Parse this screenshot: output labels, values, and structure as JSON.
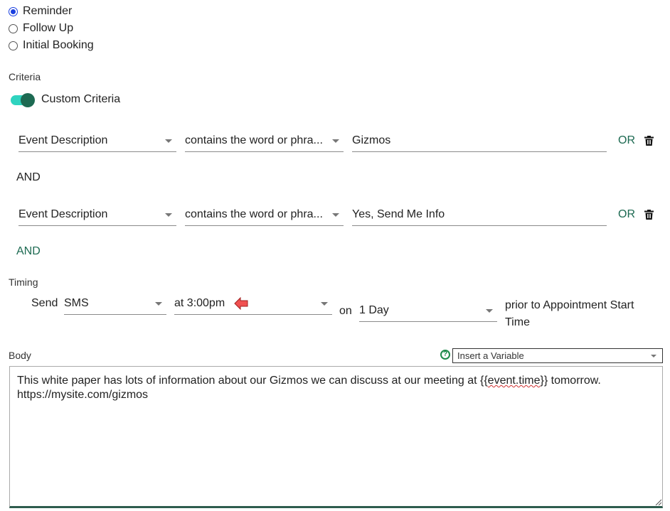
{
  "type_options": [
    {
      "label": "Reminder",
      "checked": true
    },
    {
      "label": "Follow Up",
      "checked": false
    },
    {
      "label": "Initial Booking",
      "checked": false
    }
  ],
  "criteria": {
    "section_label": "Criteria",
    "toggle_label": "Custom Criteria",
    "toggle_on": true,
    "rules": [
      {
        "field": "Event Description",
        "operator": "contains the word or phra...",
        "value": "Gizmos",
        "or_label": "OR",
        "delete_icon": "trash-icon"
      },
      {
        "field": "Event Description",
        "operator": "contains the word or phra...",
        "value": "Yes, Send Me Info",
        "or_label": "OR",
        "delete_icon": "trash-icon"
      }
    ],
    "and_separator": "AND",
    "and_button": "AND"
  },
  "timing": {
    "section_label": "Timing",
    "send_label": "Send",
    "channel": "SMS",
    "time": "at 3:00pm",
    "on_label": "on",
    "offset": "1 Day",
    "suffix": "prior to Appointment Start Time",
    "annotation_icon": "red-arrow-left-icon"
  },
  "body": {
    "section_label": "Body",
    "help_icon": "help-circle-icon",
    "insert_variable": "Insert a Variable",
    "text_before": "This white paper has lots of information about our Gizmos we can discuss at our meeting at {{",
    "text_variable": "event.time",
    "text_after": "}} tomorrow.\nhttps://mysite.com/gizmos"
  },
  "colors": {
    "accent": "#1d6a52",
    "toggle_track": "#2fd3bf",
    "radio_checked": "#1a3fe0",
    "annotation_arrow": "#f05050"
  }
}
